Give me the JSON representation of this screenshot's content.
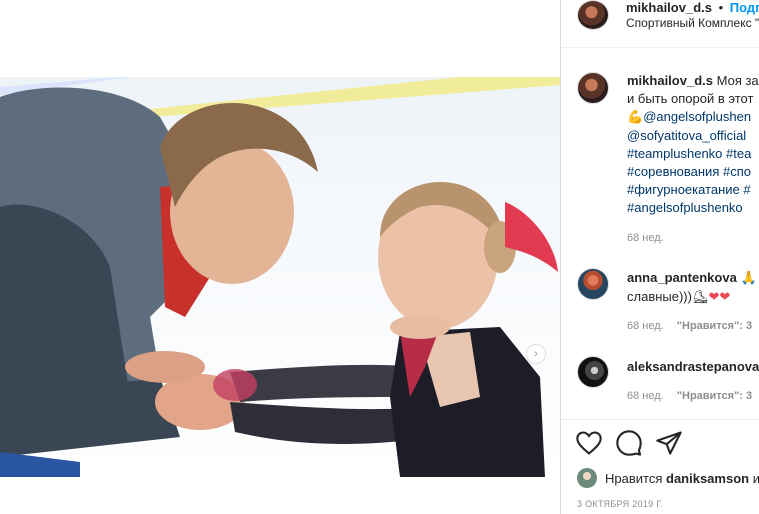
{
  "post": {
    "owner_username": "mikhailov_d.s",
    "follow_label": "Подп",
    "separator": "•",
    "location": "Спортивный Комплекс \""
  },
  "caption": {
    "username": "mikhailov_d.s",
    "lines": [
      "Моя за",
      "и быть опорой в этот",
      "@angelsofplushen",
      "@sofyatitova_official",
      "#teamplushenko #tea",
      "#соревнования #спо",
      "#фигурноекатание #",
      "#angelsofplushenko"
    ],
    "line3_emoji": "💪",
    "time": "68 нед."
  },
  "comments": [
    {
      "username": "anna_pantenkova",
      "text_emoji_1": "🙏",
      "line2": "славные)))",
      "line2_emoji": "⛸",
      "hearts": "❤❤",
      "time": "68 нед.",
      "like_label": "\"Нравится\": 3"
    },
    {
      "username": "aleksandrastepanova",
      "time": "68 нед.",
      "like_label": "\"Нравится\": 3"
    }
  ],
  "actions": {
    "like_icon": "heart-outline-icon",
    "comment_icon": "comment-bubble-icon",
    "share_icon": "paper-plane-icon"
  },
  "likes": {
    "prefix": "Нравится",
    "username": "daniksamson",
    "suffix": "и"
  },
  "date": "3 ОКТЯБРЯ 2019 Г.",
  "colors": {
    "link": "#00376b",
    "follow": "#0095f6",
    "muted": "#8e8e8e",
    "heart": "#ed4956"
  }
}
